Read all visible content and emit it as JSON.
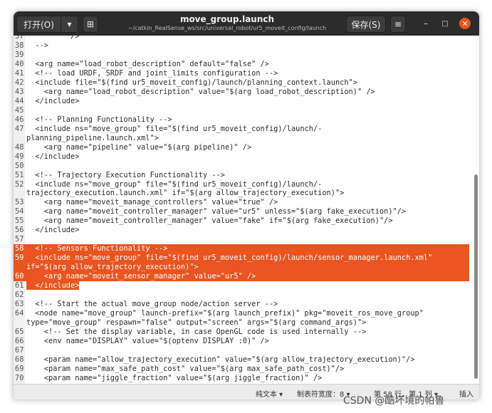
{
  "titlebar": {
    "open_label": "打开(O)",
    "open_dropdown_icon": "▾",
    "new_tab_icon": "⊞",
    "title": "move_group.launch",
    "subtitle": "~/catkin_RealSense_ws/src/universal_robot/ur5_moveit_config/launch",
    "save_label": "保存(S)",
    "menu_icon": "≡",
    "minimize_icon": "–",
    "maximize_icon": "□",
    "close_icon": "✕"
  },
  "editor": {
    "lines": [
      {
        "n": "37",
        "t": "          />"
      },
      {
        "n": "38",
        "t": "  -->"
      },
      {
        "n": "39",
        "t": ""
      },
      {
        "n": "40",
        "t": "  <arg name=\"load_robot_description\" default=\"false\" />"
      },
      {
        "n": "41",
        "t": "  <!-- load URDF, SRDF and joint_limits configuration -->"
      },
      {
        "n": "42",
        "t": "  <include file=\"$(find ur5_moveit_config)/launch/planning_context.launch\">"
      },
      {
        "n": "43",
        "t": "    <arg name=\"load_robot_description\" value=\"$(arg load_robot_description)\" />"
      },
      {
        "n": "44",
        "t": "  </include>"
      },
      {
        "n": "45",
        "t": ""
      },
      {
        "n": "46",
        "t": "  <!-- Planning Functionality -->"
      },
      {
        "n": "47",
        "t": "  <include ns=\"move_group\" file=\"$(find ur5_moveit_config)/launch/-"
      },
      {
        "n": "",
        "t": "planning_pipeline.launch.xml\">"
      },
      {
        "n": "48",
        "t": "    <arg name=\"pipeline\" value=\"$(arg pipeline)\" />"
      },
      {
        "n": "49",
        "t": "  </include>"
      },
      {
        "n": "50",
        "t": ""
      },
      {
        "n": "51",
        "t": "  <!-- Trajectory Execution Functionality -->"
      },
      {
        "n": "52",
        "t": "  <include ns=\"move_group\" file=\"$(find ur5_moveit_config)/launch/-"
      },
      {
        "n": "",
        "t": "trajectory_execution.launch.xml\" if=\"$(arg allow_trajectory_execution)\">"
      },
      {
        "n": "53",
        "t": "    <arg name=\"moveit_manage_controllers\" value=\"true\" />"
      },
      {
        "n": "54",
        "t": "    <arg name=\"moveit_controller_manager\" value=\"ur5\" unless=\"$(arg fake_execution)\"/>"
      },
      {
        "n": "55",
        "t": "    <arg name=\"moveit_controller_manager\" value=\"fake\" if=\"$(arg fake_execution)\"/>"
      },
      {
        "n": "56",
        "t": "  </include>"
      },
      {
        "n": "57",
        "t": ""
      },
      {
        "n": "58",
        "t": "  <!-- Sensors Functionality -->"
      },
      {
        "n": "59",
        "t": "  <include ns=\"move_group\" file=\"$(find ur5_moveit_config)/launch/sensor_manager.launch.xml\""
      },
      {
        "n": "",
        "t": "if=\"$(arg allow_trajectory_execution)\">"
      },
      {
        "n": "60",
        "t": "    <arg name=\"moveit_sensor_manager\" value=\"ur5\" />"
      },
      {
        "n": "61",
        "t": "  </include>"
      },
      {
        "n": "62",
        "t": ""
      },
      {
        "n": "63",
        "t": "  <!-- Start the actual move_group node/action server -->"
      },
      {
        "n": "64",
        "t": "  <node name=\"move_group\" launch-prefix=\"$(arg launch_prefix)\" pkg=\"moveit_ros_move_group\""
      },
      {
        "n": "",
        "t": "type=\"move_group\" respawn=\"false\" output=\"screen\" args=\"$(arg command_args)\">"
      },
      {
        "n": "65",
        "t": "    <!-- Set the display variable, in case OpenGL code is used internally -->"
      },
      {
        "n": "66",
        "t": "    <env name=\"DISPLAY\" value=\"$(optenv DISPLAY :0)\" />"
      },
      {
        "n": "67",
        "t": ""
      },
      {
        "n": "68",
        "t": "    <param name=\"allow_trajectory_execution\" value=\"$(arg allow_trajectory_execution)\"/>"
      },
      {
        "n": "69",
        "t": "    <param name=\"max_safe_path_cost\" value=\"$(arg max_safe_path_cost)\"/>"
      },
      {
        "n": "70",
        "t": "    <param name=\"jiggle_fraction\" value=\"$(arg jiggle_fraction)\" />"
      }
    ],
    "selected_rows": [
      23,
      24,
      25,
      26
    ],
    "partial_row": 27,
    "selection_color": "#e95420"
  },
  "statusbar": {
    "language": "纯文本 ▾",
    "tab_width": "制表符宽度：8 ▾",
    "position": "第 58 行，第 1 列 ▾",
    "mode": "插入"
  },
  "watermark": "CSDN @酷坏境的帕鲁"
}
